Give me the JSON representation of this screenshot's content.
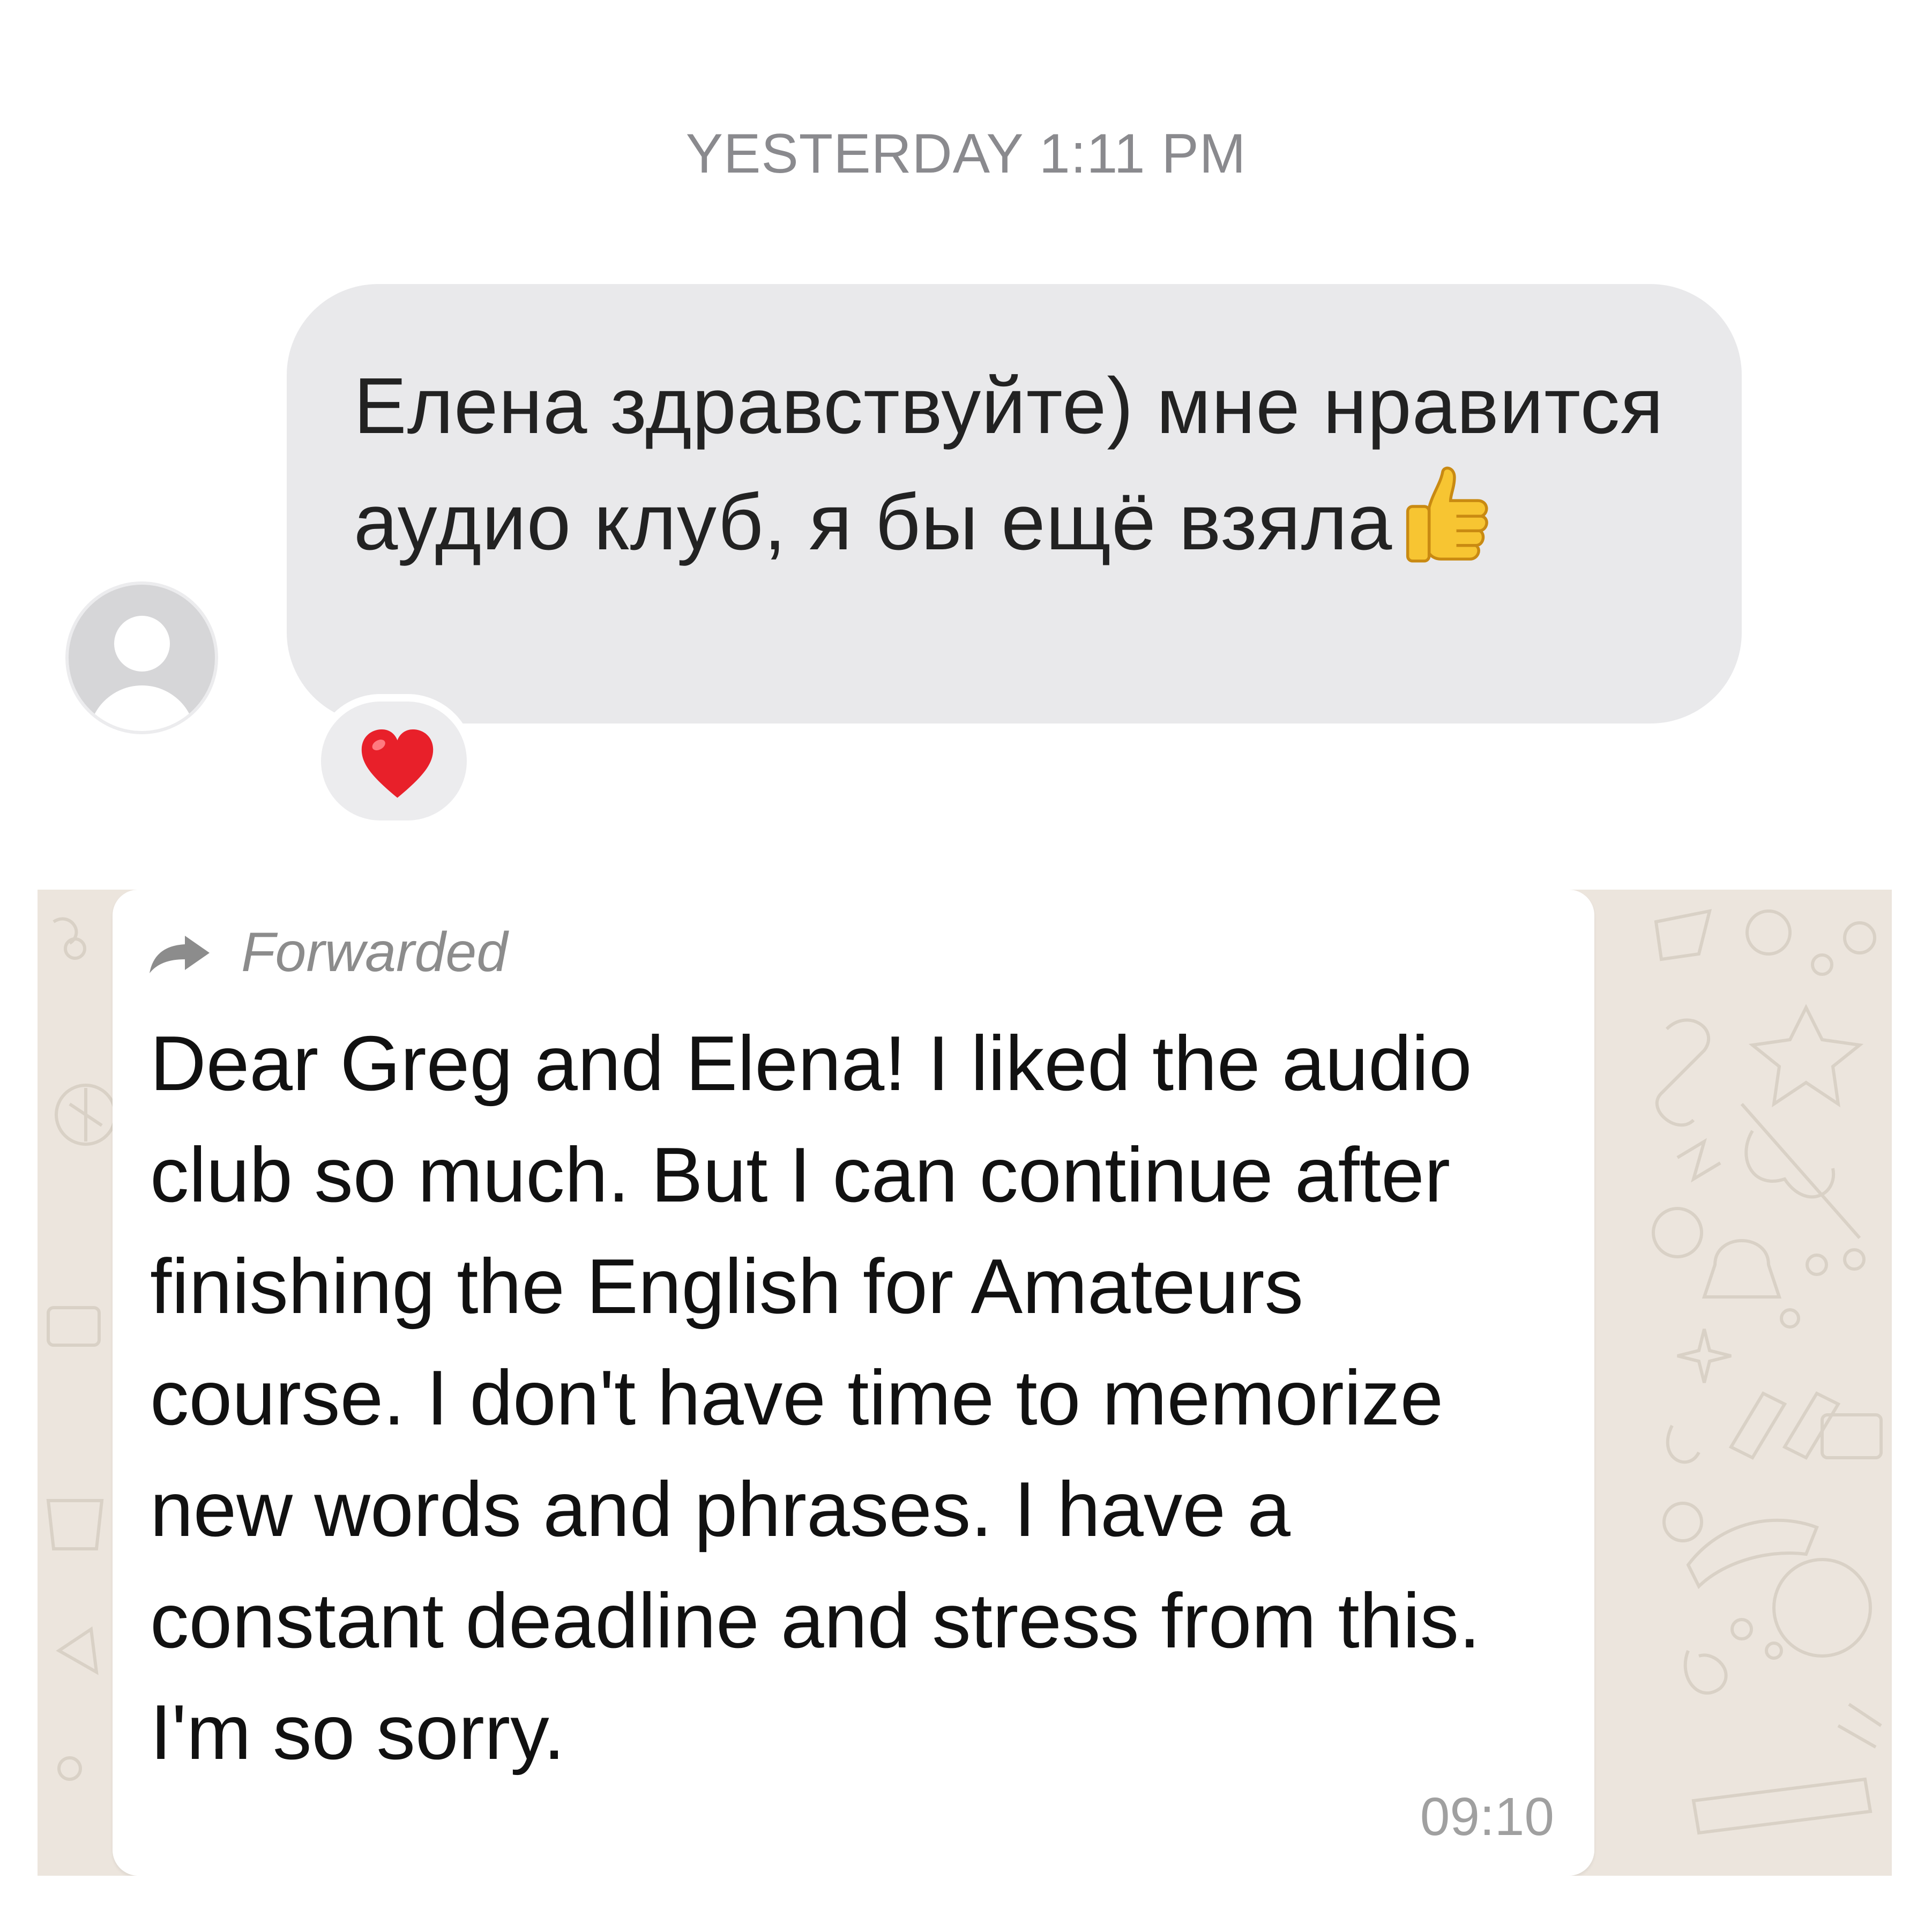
{
  "imessage": {
    "timestamp": "YESTERDAY 1:11 PM",
    "incoming_message": {
      "text": "Елена здравствуйте) мне нравится аудио клуб, я бы ещё взяла",
      "emoji": "thumbs-up-icon"
    },
    "reaction": "heart-icon"
  },
  "whatsapp": {
    "forwarded_label": "Forwarded",
    "message_text": "Dear Greg and Elena! I liked the audio club so much. But I can continue after finishing the English for Amateurs course. I don't have time to memorize new words and phrases.  I have a constant deadline and stress from this. I'm so sorry.",
    "time": "09:10"
  },
  "colors": {
    "imessage_bubble": "#e9e9eb",
    "imessage_timestamp": "#8a8a8e",
    "whatsapp_background": "#ece5dd",
    "whatsapp_bubble": "#ffffff",
    "whatsapp_meta": "#8c8c8c",
    "heart": "#e8202a",
    "thumb": "#f7c532"
  }
}
